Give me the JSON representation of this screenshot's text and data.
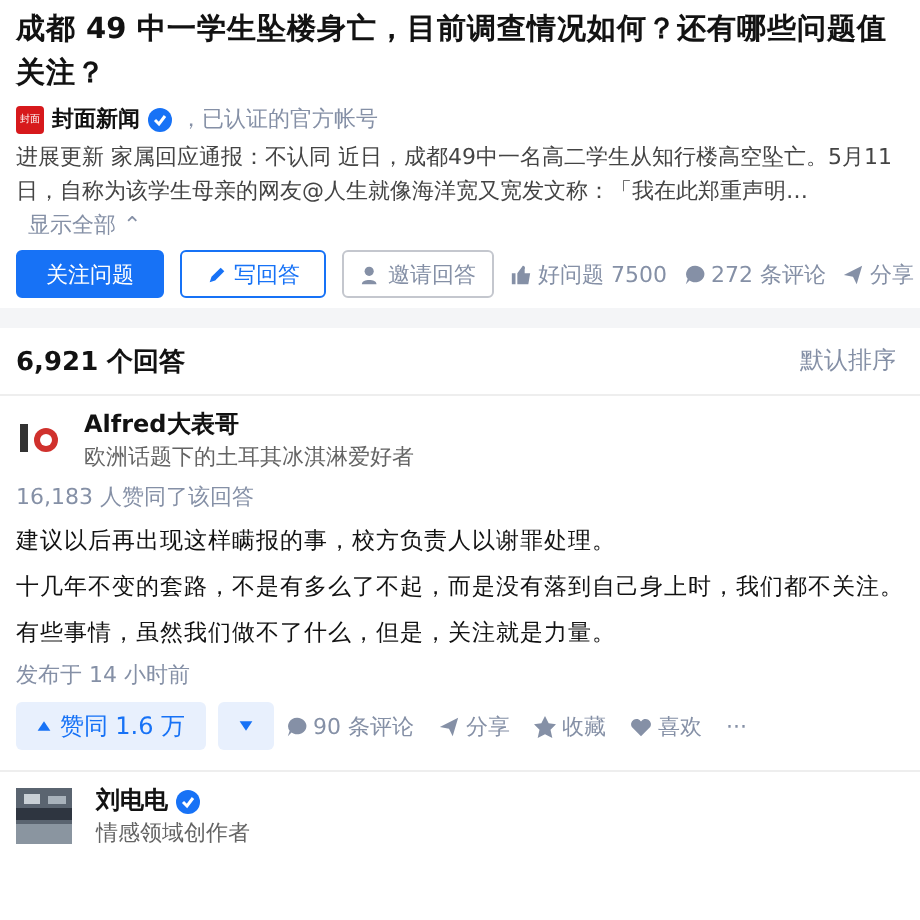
{
  "question": {
    "title_lines": [
      "成都 49 中一学生坠楼身亡，目前调查情况如何？还有哪些问题值",
      "关注？"
    ],
    "source": {
      "name": "封面新闻",
      "logo": "封面",
      "verified": true,
      "note": "，已认证的官方帐号"
    },
    "excerpt": "进展更新 家属回应通报：不认同 近日，成都49中一名高二学生从知行楼高空坠亡。5月11日，自称为该学生母亲的网友@人生就像海洋宽又宽发文称：「我在此郑重声明…",
    "show_all": "显示全部 ⌃",
    "buttons": [
      {
        "kind": "primary",
        "label": "关注问题"
      },
      {
        "kind": "outline",
        "label": "写回答"
      },
      {
        "kind": "plain",
        "label": "邀请回答"
      }
    ],
    "actions": [
      {
        "kind": "like",
        "label": "好问题 7500"
      },
      {
        "kind": "comment",
        "label": "272 条评论"
      },
      {
        "kind": "share",
        "label": "分享"
      }
    ]
  },
  "answers_header": {
    "count": "6,921 个回答",
    "sort": "默认排序"
  },
  "answer": {
    "author": "Alfred大表哥",
    "bio": "欧洲话题下的土耳其冰淇淋爱好者",
    "upvoters": "16,183 人赞同了该回答",
    "paragraphs": [
      "建议以后再出现这样瞒报的事，校方负责人以谢罪处理。",
      "十几年不变的套路，不是有多么了不起，而是没有落到自己身上时，我们都不关注。",
      "有些事情，虽然我们做不了什么，但是，关注就是力量。"
    ],
    "time": "发布于 14 小时前",
    "vote": "赞同 1.6 万",
    "actions": [
      {
        "kind": "comment",
        "label": "90 条评论"
      },
      {
        "kind": "share",
        "label": "分享"
      },
      {
        "kind": "star",
        "label": "收藏"
      },
      {
        "kind": "heart",
        "label": "喜欢"
      },
      {
        "kind": "more",
        "label": "···"
      }
    ]
  },
  "next_answer": {
    "author": "刘电电",
    "verified": true,
    "bio": "情感领域创作者"
  }
}
